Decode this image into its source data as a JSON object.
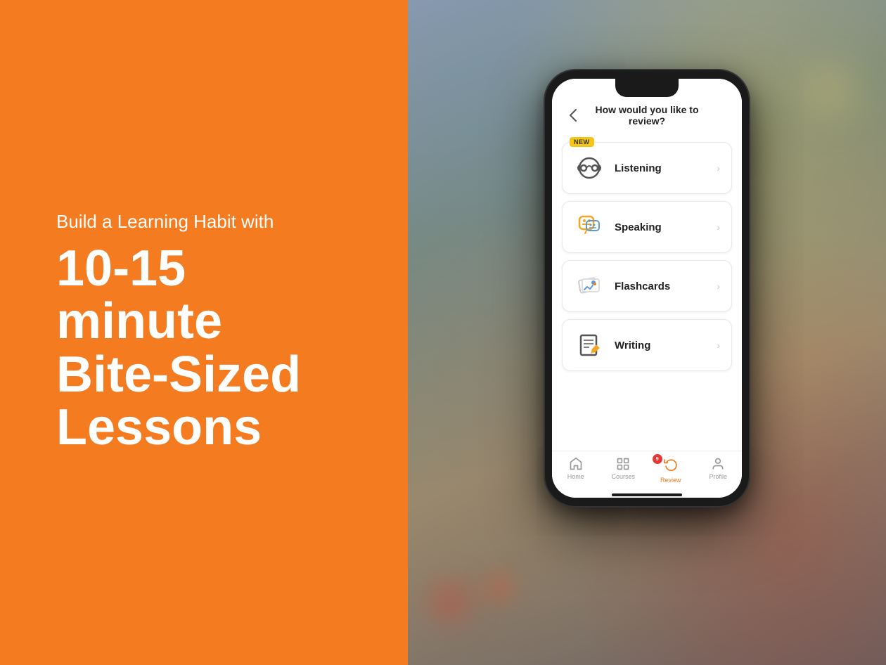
{
  "left": {
    "subtitle": "Build a Learning Habit with",
    "headline_line1": "10-15 minute",
    "headline_line2": "Bite-Sized",
    "headline_line3": "Lessons"
  },
  "app": {
    "header_title": "How would you like to review?",
    "back_label": "‹",
    "review_options": [
      {
        "id": "listening",
        "label": "Listening",
        "is_new": true
      },
      {
        "id": "speaking",
        "label": "Speaking",
        "is_new": false
      },
      {
        "id": "flashcards",
        "label": "Flashcards",
        "is_new": false
      },
      {
        "id": "writing",
        "label": "Writing",
        "is_new": false
      }
    ],
    "nav": [
      {
        "id": "home",
        "label": "Home",
        "active": false
      },
      {
        "id": "courses",
        "label": "Courses",
        "active": false
      },
      {
        "id": "review",
        "label": "Review",
        "active": true,
        "badge": "9"
      },
      {
        "id": "profile",
        "label": "Profile",
        "active": false
      }
    ],
    "new_badge_text": "NEW"
  }
}
